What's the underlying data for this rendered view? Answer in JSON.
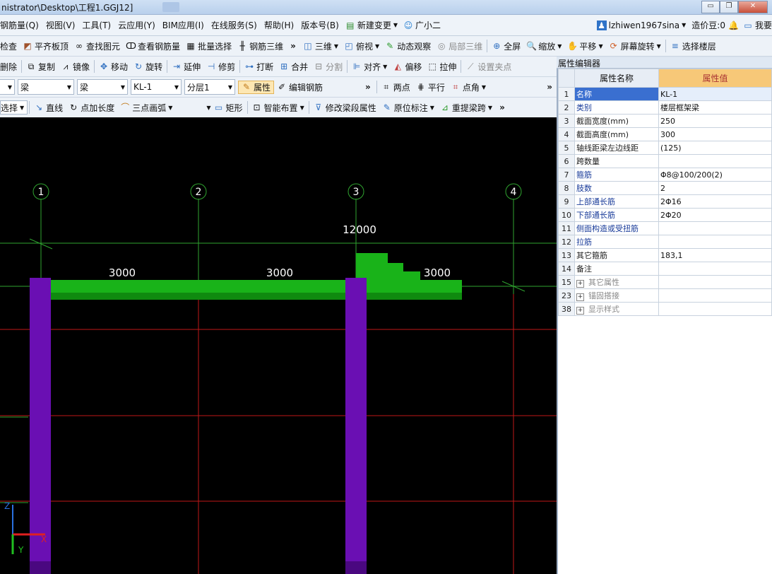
{
  "window": {
    "title": "nistrator\\Desktop\\工程1.GGJ12]",
    "minimize": "▭",
    "maximize": "❐",
    "close": "✕"
  },
  "menu": {
    "items": [
      "钢筋量(Q)",
      "视图(V)",
      "工具(T)",
      "云应用(Y)",
      "BIM应用(I)",
      "在线服务(S)",
      "帮助(H)",
      "版本号(B)"
    ],
    "new_change": "新建变更",
    "guangxiaoer": "广小二",
    "user": "lzhiwen1967sina",
    "cost_bean": "造价豆:0",
    "right_cut": "我要"
  },
  "toolbar1": {
    "items": [
      "检查",
      "平齐板顶",
      "查找图元",
      "查看钢筋量",
      "批量选择",
      "钢筋三维"
    ],
    "view_3d": "三维",
    "top_view": "俯视",
    "dynamic": "动态观察",
    "local_3d": "局部三维",
    "fullscreen": "全屏",
    "zoom": "缩放",
    "pan": "平移",
    "rotate_screen": "屏幕旋转",
    "select_floor": "选择楼层"
  },
  "toolbar2": {
    "items": [
      "删除",
      "复制",
      "镜像",
      "移动",
      "旋转",
      "延伸",
      "修剪",
      "打断",
      "合并",
      "分割",
      "对齐",
      "偏移",
      "拉伸",
      "设置夹点"
    ]
  },
  "toolbar3": {
    "combo_blank": "",
    "combo_type": "梁",
    "combo_subtype": "梁",
    "combo_name": "KL-1",
    "combo_layer": "分层1",
    "properties": "属性",
    "edit_rebar": "编辑钢筋",
    "two_points": "两点",
    "parallel": "平行",
    "point_angle": "点角"
  },
  "toolbar4": {
    "select": "选择",
    "line": "直线",
    "point_length": "点加长度",
    "three_point_arc": "三点画弧",
    "rect": "矩形",
    "smart_layout": "智能布置",
    "modify_segment": "修改梁段属性",
    "original_mark": "原位标注",
    "re_extract_span": "重提梁跨"
  },
  "canvas": {
    "axes": [
      "1",
      "2",
      "3",
      "4"
    ],
    "total_dim": "12000",
    "span_dims": [
      "3000",
      "3000",
      "3000"
    ],
    "axis_z": "Z",
    "axis_x": "X",
    "axis_y": "Y"
  },
  "property_editor": {
    "title": "属性编辑器",
    "header_name": "属性名称",
    "header_value": "属性值",
    "rows": [
      {
        "num": "1",
        "name": "名称",
        "value": "KL-1"
      },
      {
        "num": "2",
        "name": "类别",
        "value": "楼层框架梁"
      },
      {
        "num": "3",
        "name": "截面宽度(mm)",
        "value": "250"
      },
      {
        "num": "4",
        "name": "截面高度(mm)",
        "value": "300"
      },
      {
        "num": "5",
        "name": "轴线距梁左边线距",
        "value": "(125)"
      },
      {
        "num": "6",
        "name": "跨数量",
        "value": ""
      },
      {
        "num": "7",
        "name": "箍筋",
        "value": "Φ8@100/200(2)"
      },
      {
        "num": "8",
        "name": "肢数",
        "value": "2"
      },
      {
        "num": "9",
        "name": "上部通长筋",
        "value": "2Φ16"
      },
      {
        "num": "10",
        "name": "下部通长筋",
        "value": "2Φ20"
      },
      {
        "num": "11",
        "name": "侧面构造或受扭筋",
        "value": ""
      },
      {
        "num": "12",
        "name": "拉筋",
        "value": ""
      },
      {
        "num": "13",
        "name": "其它箍筋",
        "value": "183,1"
      },
      {
        "num": "14",
        "name": "备注",
        "value": ""
      },
      {
        "num": "15",
        "name": "其它属性",
        "value": ""
      },
      {
        "num": "23",
        "name": "锚固搭接",
        "value": ""
      },
      {
        "num": "38",
        "name": "显示样式",
        "value": ""
      }
    ],
    "expand_symbol": "+"
  },
  "colors": {
    "beam": "#19b319",
    "column": "#6a0fb3",
    "axis_line": "#2fa32f",
    "grid_red": "#c01818",
    "selected_row": "#3a6fd0"
  }
}
